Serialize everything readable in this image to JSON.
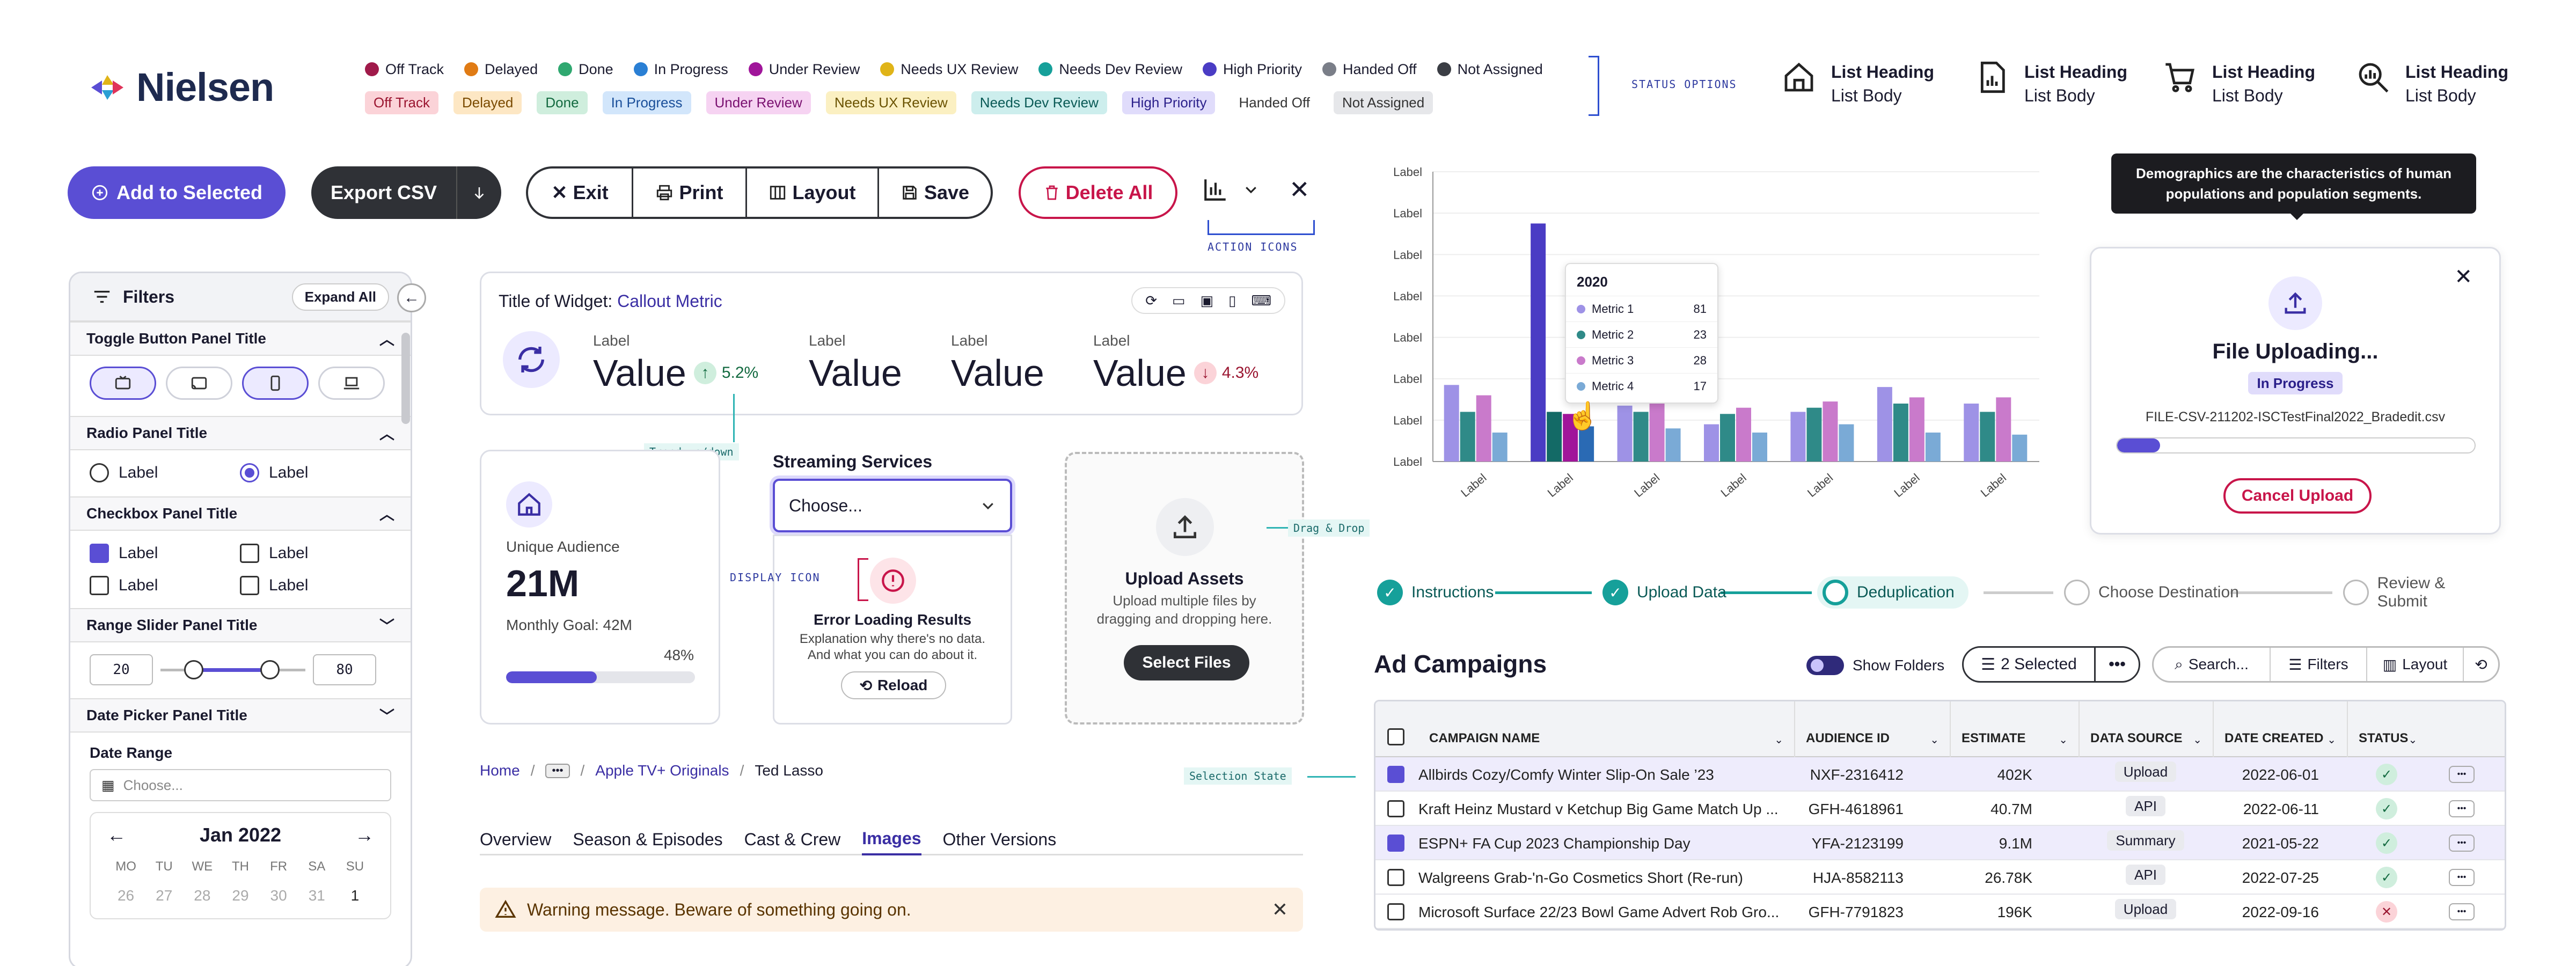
{
  "logo": {
    "text": "Nielsen"
  },
  "status_legend": [
    {
      "label": "Off Track",
      "color": "#a01a4a"
    },
    {
      "label": "Delayed",
      "color": "#e07b14"
    },
    {
      "label": "Done",
      "color": "#2fa870"
    },
    {
      "label": "In Progress",
      "color": "#2a7fd4"
    },
    {
      "label": "Under Review",
      "color": "#a0159a"
    },
    {
      "label": "Needs UX Review",
      "color": "#e0b418"
    },
    {
      "label": "Needs Dev Review",
      "color": "#16a09a"
    },
    {
      "label": "High Priority",
      "color": "#4a3cc4"
    },
    {
      "label": "Handed Off",
      "color": "#7a7e88"
    },
    {
      "label": "Not Assigned",
      "color": "#3a3d44"
    }
  ],
  "status_pills": [
    {
      "label": "Off Track",
      "bg": "#fbd3d8",
      "fg": "#9a1530"
    },
    {
      "label": "Delayed",
      "bg": "#fde7c4",
      "fg": "#7a4a00"
    },
    {
      "label": "Done",
      "bg": "#cfeedd",
      "fg": "#136a40"
    },
    {
      "label": "In Progress",
      "bg": "#d2e6fb",
      "fg": "#1a4f9a"
    },
    {
      "label": "Under Review",
      "bg": "#f6d3f2",
      "fg": "#7a1070"
    },
    {
      "label": "Needs UX Review",
      "bg": "#fbf0c2",
      "fg": "#6a5200"
    },
    {
      "label": "Needs Dev Review",
      "bg": "#cdeeed",
      "fg": "#0a5a56"
    },
    {
      "label": "High Priority",
      "bg": "#e0dcfb",
      "fg": "#2a1f8a"
    },
    {
      "label": "Handed Off",
      "bg": "#ffffff",
      "fg": "#333333"
    },
    {
      "label": "Not Assigned",
      "bg": "#e6e7ea",
      "fg": "#333333"
    }
  ],
  "status_note": "STATUS OPTIONS",
  "list_items": [
    {
      "heading": "List Heading",
      "body": "List Body",
      "icon": "home-icon"
    },
    {
      "heading": "List Heading",
      "body": "List Body",
      "icon": "report-icon"
    },
    {
      "heading": "List Heading",
      "body": "List Body",
      "icon": "cart-icon"
    },
    {
      "heading": "List Heading",
      "body": "List Body",
      "icon": "search-chart-icon"
    }
  ],
  "toolbar": {
    "add_selected": "Add to Selected",
    "export_csv": "Export CSV",
    "exit": "Exit",
    "print": "Print",
    "layout": "Layout",
    "save": "Save",
    "delete_all": "Delete All",
    "action_icons_note": "ACTION ICONS"
  },
  "sidebar": {
    "title": "Filters",
    "expand_all": "Expand All",
    "toggle_panel": "Toggle Button Panel Title",
    "radio_panel": "Radio Panel Title",
    "radio_options": [
      "Label",
      "Label"
    ],
    "checkbox_panel": "Checkbox Panel Title",
    "checkbox_options": [
      "Label",
      "Label",
      "Label",
      "Label"
    ],
    "range_panel": "Range Slider Panel Title",
    "range_min": "20",
    "range_max": "80",
    "date_panel": "Date Picker Panel Title",
    "date_range_label": "Date Range",
    "date_placeholder": "Choose...",
    "month": "Jan 2022",
    "weekdays": [
      "MO",
      "TU",
      "WE",
      "TH",
      "FR",
      "SA",
      "SU"
    ],
    "days": [
      "26",
      "27",
      "28",
      "29",
      "30",
      "31",
      "1"
    ]
  },
  "widget": {
    "title_prefix": "Title of Widget:",
    "title_link": "Callout Metric",
    "metrics": [
      {
        "label": "Label",
        "value": "Value",
        "trend": "5.2%",
        "dir": "up"
      },
      {
        "label": "Label",
        "value": "Value",
        "trend": "",
        "dir": ""
      },
      {
        "label": "Label",
        "value": "Value",
        "trend": "",
        "dir": ""
      },
      {
        "label": "Label",
        "value": "Value",
        "trend": "4.3%",
        "dir": "down"
      }
    ],
    "trend_note": "Trend up/down"
  },
  "audience": {
    "label": "Unique Audience",
    "value": "21M",
    "goal": "Monthly Goal: 42M",
    "pct": "48%",
    "progress": 0.48
  },
  "streaming": {
    "label": "Streaming Services",
    "placeholder": "Choose...",
    "display_icon_note": "DISPLAY ICON",
    "error_title": "Error Loading Results",
    "error_body_1": "Explanation why there's no data.",
    "error_body_2": "And what you can do about it.",
    "reload": "Reload"
  },
  "upload_assets": {
    "title": "Upload Assets",
    "body_1": "Upload multiple files by",
    "body_2": "dragging and dropping here.",
    "button": "Select Files",
    "note": "Drag & Drop"
  },
  "breadcrumb": {
    "home": "Home",
    "more": "•••",
    "parent": "Apple TV+ Originals",
    "current": "Ted Lasso"
  },
  "tabs": [
    "Overview",
    "Season & Episodes",
    "Cast & Crew",
    "Images",
    "Other Versions"
  ],
  "active_tab": 3,
  "warning": "Warning message. Beware of something going on.",
  "selection_note": "Selection State",
  "chart_data": {
    "type": "bar",
    "categories": [
      "Label",
      "Label",
      "Label",
      "Label",
      "Label",
      "Label",
      "Label"
    ],
    "y_tick_labels": [
      "Label",
      "Label",
      "Label",
      "Label",
      "Label",
      "Label",
      "Label",
      "Label"
    ],
    "series": [
      {
        "color": "#9e92e6",
        "values": [
          37,
          26,
          27,
          18,
          24,
          36,
          28
        ]
      },
      {
        "color": "#2f8a88",
        "values": [
          24,
          24,
          24,
          23,
          26,
          28,
          24
        ]
      },
      {
        "color": "#c97acb",
        "values": [
          32,
          31,
          31,
          26,
          29,
          31,
          31
        ]
      },
      {
        "color": "#7aaad6",
        "values": [
          14,
          25,
          16,
          14,
          18,
          14,
          13
        ]
      }
    ],
    "highlight": {
      "category_index": 1,
      "values": [
        115,
        24,
        23,
        17
      ],
      "colors": [
        "#4a3cc4",
        "#136a66",
        "#a0159a",
        "#2a6ab4"
      ]
    },
    "ylim": [
      0,
      140
    ],
    "tooltip": {
      "title": "2020",
      "rows": [
        {
          "name": "Metric 1",
          "value": "81",
          "color": "#9e92e6"
        },
        {
          "name": "Metric 2",
          "value": "23",
          "color": "#2f8a88"
        },
        {
          "name": "Metric 3",
          "value": "28",
          "color": "#c97acb"
        },
        {
          "name": "Metric 4",
          "value": "17",
          "color": "#7aaad6"
        }
      ]
    }
  },
  "demographics_tooltip": "Demographics are the characteristics of human populations and population segments.",
  "file_upload": {
    "title": "File Uploading...",
    "status": "In Progress",
    "filename": "FILE-CSV-211202-ISCTestFinal2022_Bradedit.csv",
    "progress": 0.12,
    "cancel": "Cancel Upload"
  },
  "stepper": [
    {
      "label": "Instructions",
      "state": "done"
    },
    {
      "label": "Upload Data",
      "state": "done"
    },
    {
      "label": "Deduplication",
      "state": "active"
    },
    {
      "label": "Choose Destination",
      "state": "todo"
    },
    {
      "label": "Review & Submit",
      "state": "todo"
    }
  ],
  "campaigns": {
    "title": "Ad Campaigns",
    "show_folders": "Show Folders",
    "selected": "2 Selected",
    "search": "Search...",
    "filters": "Filters",
    "layout": "Layout",
    "columns": [
      "CAMPAIGN NAME",
      "AUDIENCE ID",
      "ESTIMATE",
      "DATA SOURCE",
      "DATE CREATED",
      "STATUS"
    ],
    "rows": [
      {
        "checked": true,
        "name": "Allbirds Cozy/Comfy Winter Slip-On Sale ’23",
        "id": "NXF-2316412",
        "est": "402K",
        "src": "Upload",
        "date": "2022-06-01",
        "ok": true
      },
      {
        "checked": false,
        "name": "Kraft Heinz Mustard v Ketchup Big Game Match Up ...",
        "id": "GFH-4618961",
        "est": "40.7M",
        "src": "API",
        "date": "2022-06-11",
        "ok": true
      },
      {
        "checked": true,
        "name": "ESPN+ FA Cup 2023 Championship Day",
        "id": "YFA-2123199",
        "est": "9.1M",
        "src": "Summary",
        "date": "2021-05-22",
        "ok": true
      },
      {
        "checked": false,
        "name": "Walgreens Grab-'n-Go Cosmetics Short (Re-run)",
        "id": "HJA-8582113",
        "est": "26.78K",
        "src": "API",
        "date": "2022-07-25",
        "ok": true
      },
      {
        "checked": false,
        "name": "Microsoft Surface 22/23 Bowl Game Advert Rob Gro...",
        "id": "GFH-7791823",
        "est": "196K",
        "src": "Upload",
        "date": "2022-09-16",
        "ok": false
      }
    ]
  }
}
